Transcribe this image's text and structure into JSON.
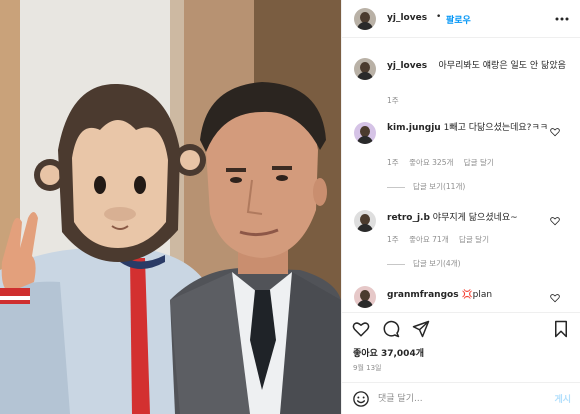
{
  "header": {
    "username": "yj_loves",
    "separator": "•",
    "follow_label": "팔로우",
    "more_icon": "more-dots-icon"
  },
  "caption": {
    "username": "yj_loves",
    "text": "아무리봐도 얘랑은 일도 안 닮았음",
    "time": "1주"
  },
  "comments": [
    {
      "username": "kim.jungju",
      "text": "1빼고 다닮으셨는데요?ㅋㅋ",
      "time": "1주",
      "likes": "좋아요 325개",
      "reply": "답글 달기",
      "view_replies": "답글 보기(11개)"
    },
    {
      "username": "retro_j.b",
      "text": "야무지게 닮으셨네요~",
      "time": "1주",
      "likes": "좋아요 71개",
      "reply": "답글 달기",
      "view_replies": "답글 보기(4개)"
    },
    {
      "username": "granmfrangos",
      "text": "💢plan"
    }
  ],
  "actions": {
    "like_icon": "heart-icon",
    "comment_icon": "comment-icon",
    "share_icon": "send-icon",
    "save_icon": "bookmark-icon"
  },
  "likes_text": "좋아요 37,004개",
  "date_text": "9월 13일",
  "comment_box": {
    "placeholder": "댓글 달기...",
    "post_label": "게시",
    "emoji_icon": "smile-icon"
  },
  "colors": {
    "accent": "#0095f6",
    "post_disabled": "#b2dffc",
    "text": "#262626",
    "muted": "#8e8e8e"
  }
}
